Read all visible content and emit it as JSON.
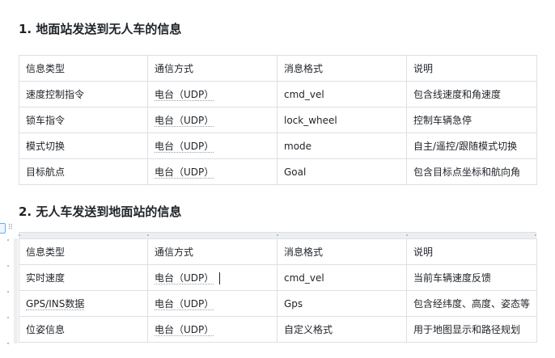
{
  "section1": {
    "title": "1. 地面站发送到无人车的信息",
    "headers": [
      "信息类型",
      "通信方式",
      "消息格式",
      "说明"
    ],
    "rows": [
      [
        "速度控制指令",
        "电台（UDP）",
        "cmd_vel",
        "包含线速度和角速度"
      ],
      [
        "锁车指令",
        "电台（UDP）",
        "lock_wheel",
        "控制车辆急停"
      ],
      [
        "模式切换",
        "电台（UDP）",
        "mode",
        "自主/遥控/跟随模式切换"
      ],
      [
        "目标航点",
        "电台（UDP）",
        "Goal",
        "包含目标点坐标和航向角"
      ]
    ]
  },
  "section2": {
    "title": "2. 无人车发送到地面站的信息",
    "headers": [
      "信息类型",
      "通信方式",
      "消息格式",
      "说明"
    ],
    "rows": [
      [
        "实时速度",
        "电台（UDP）",
        "cmd_vel",
        "当前车辆速度反馈"
      ],
      [
        "GPS/INS数据",
        "电台（UDP）",
        "Gps",
        "包含经纬度、高度、姿态等"
      ],
      [
        "位姿信息",
        "电台（UDP）",
        "自定义格式",
        "用于地图显示和路径规划"
      ]
    ]
  },
  "icons": {
    "drag_handle": "drag-handle-icon",
    "table_handle": "table-select-handle-icon"
  }
}
